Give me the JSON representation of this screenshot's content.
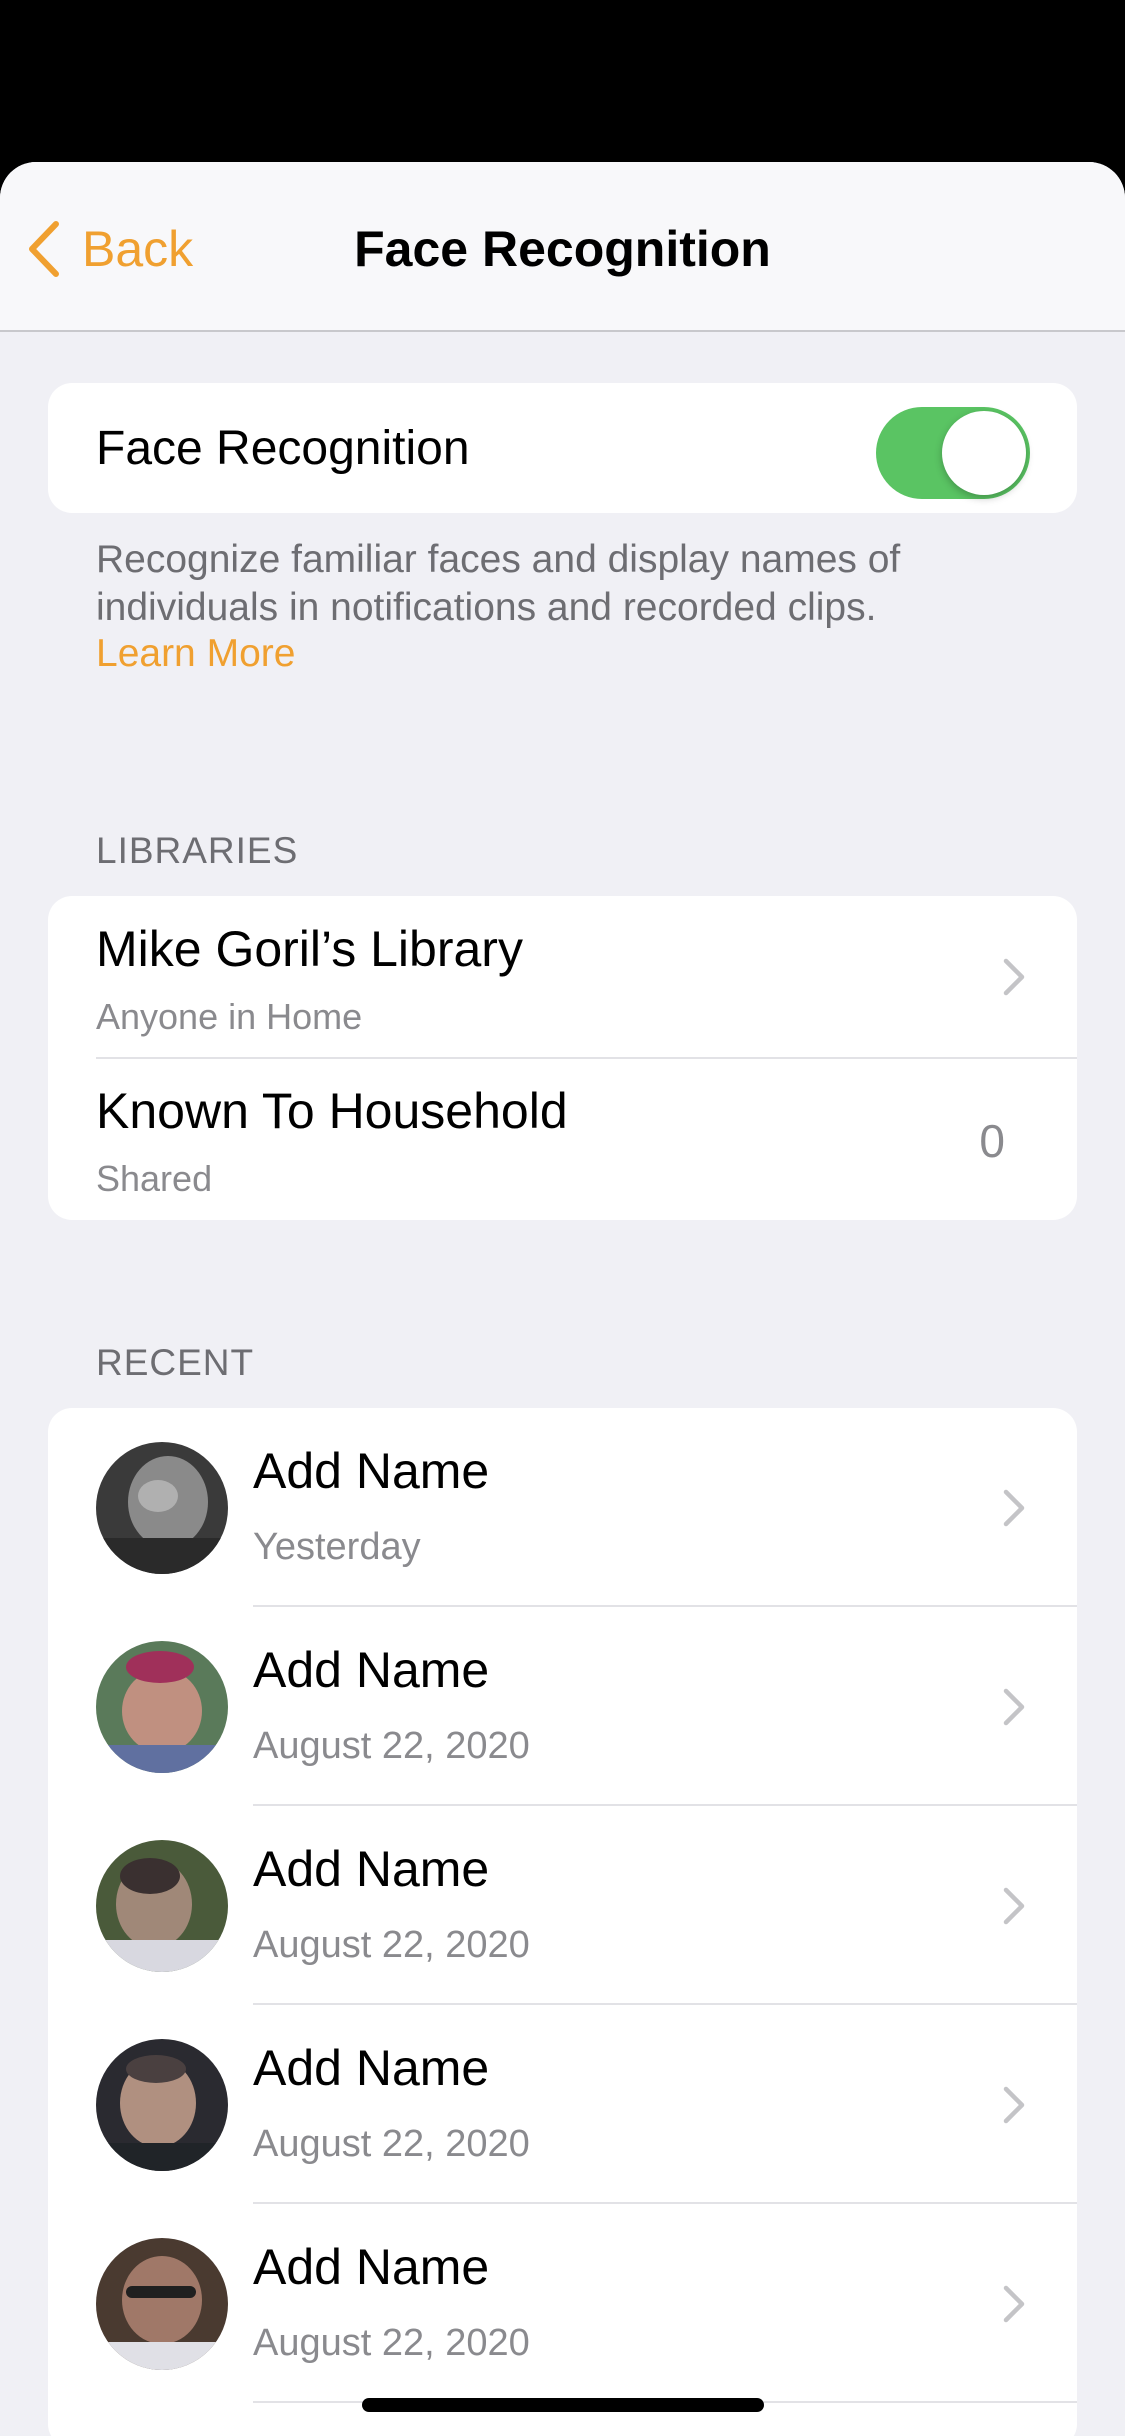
{
  "nav": {
    "back_label": "Back",
    "title": "Face Recognition"
  },
  "toggle_section": {
    "label": "Face Recognition",
    "enabled": true,
    "footnote": "Recognize familiar faces and display names of individuals in notifications and recorded clips.",
    "learn_more": "Learn More"
  },
  "libraries": {
    "header": "LIBRARIES",
    "items": [
      {
        "title": "Mike Goril’s Library",
        "subtitle": "Anyone in Home"
      },
      {
        "title": "Known To Household",
        "subtitle": "Shared",
        "count": "0"
      }
    ]
  },
  "recent": {
    "header": "RECENT",
    "items": [
      {
        "title": "Add Name",
        "date": "Yesterday"
      },
      {
        "title": "Add Name",
        "date": "August 22, 2020"
      },
      {
        "title": "Add Name",
        "date": "August 22, 2020"
      },
      {
        "title": "Add Name",
        "date": "August 22, 2020"
      },
      {
        "title": "Add Name",
        "date": "August 22, 2020"
      }
    ]
  },
  "colors": {
    "accent": "#f0a030",
    "toggle_on": "#5ac463",
    "background": "#f0f0f5"
  }
}
